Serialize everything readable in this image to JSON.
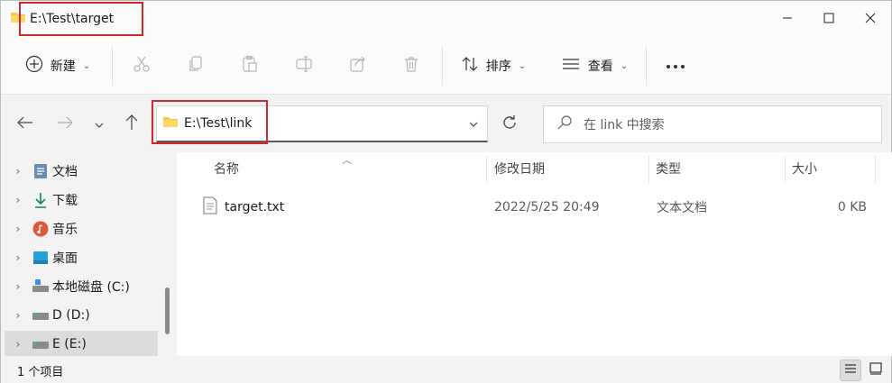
{
  "window": {
    "title": "E:\\Test\\target"
  },
  "toolbar": {
    "new_label": "新建",
    "sort_label": "排序",
    "view_label": "查看"
  },
  "address": {
    "path": "E:\\Test\\link"
  },
  "search": {
    "placeholder": "在 link 中搜索"
  },
  "nav": {
    "items": [
      {
        "label": "文档",
        "icon": "documents-icon"
      },
      {
        "label": "下载",
        "icon": "download-icon"
      },
      {
        "label": "音乐",
        "icon": "music-icon"
      },
      {
        "label": "桌面",
        "icon": "desktop-icon"
      },
      {
        "label": "本地磁盘 (C:)",
        "icon": "drive-icon"
      },
      {
        "label": "D (D:)",
        "icon": "drive-icon"
      },
      {
        "label": "E (E:)",
        "icon": "drive-icon",
        "selected": true
      }
    ]
  },
  "columns": {
    "name": "名称",
    "modified": "修改日期",
    "type": "类型",
    "size": "大小"
  },
  "files": [
    {
      "name": "target.txt",
      "modified": "2022/5/25 20:49",
      "type": "文本文档",
      "size": "0 KB"
    }
  ],
  "status": {
    "count": "1 个项目"
  },
  "colors": {
    "highlight": "#d8262d",
    "folder": "#f4c44b",
    "selected_bg": "#dcdcdc"
  }
}
